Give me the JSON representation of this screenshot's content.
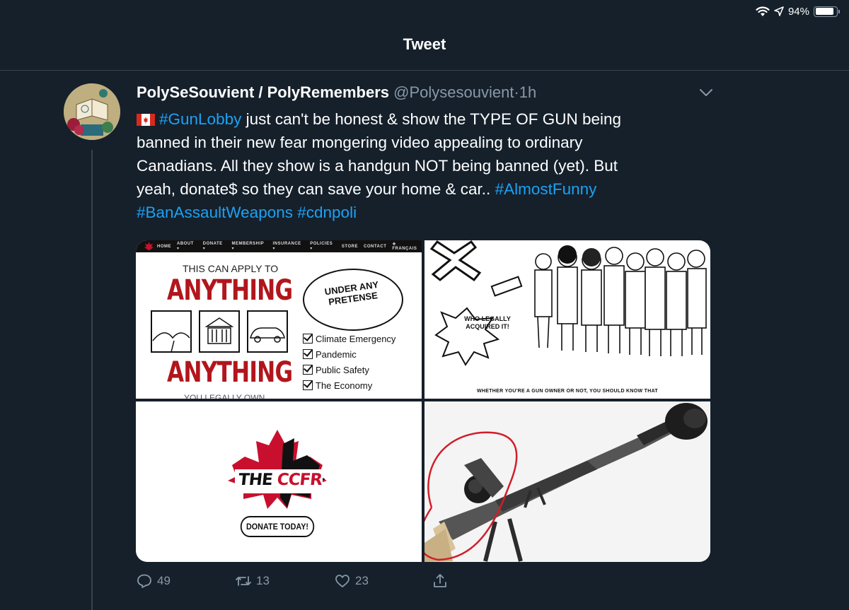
{
  "status_bar": {
    "battery": "94%",
    "battery_level": 0.94,
    "icons": [
      "wifi-icon",
      "location-icon",
      "battery-icon"
    ]
  },
  "header": {
    "title": "Tweet"
  },
  "tweet": {
    "author_name": "PolySeSouvient / PolyRemembers",
    "handle": "@Polysesouvient",
    "separator": "·",
    "time": "1h",
    "lines": [
      [
        {
          "t": "flag",
          "v": "canada-flag-icon"
        },
        {
          "t": "link",
          "v": "#GunLobby"
        },
        {
          "t": "text",
          "v": " just can't be honest & show the TYPE OF GUN being"
        }
      ],
      [
        {
          "t": "text",
          "v": "banned in their new fear mongering video appealing to ordinary"
        }
      ],
      [
        {
          "t": "text",
          "v": "Canadians. All they show is a handgun NOT being banned (yet). But"
        }
      ],
      [
        {
          "t": "text",
          "v": "yeah, donate$ so they can save your home & car.. "
        },
        {
          "t": "link",
          "v": "#AlmostFunny"
        }
      ],
      [
        {
          "t": "link",
          "v": "#BanAssaultWeapons"
        },
        {
          "t": "text",
          "v": " "
        },
        {
          "t": "link",
          "v": "#cdnpoli"
        }
      ]
    ],
    "media": {
      "image1": {
        "nav_items": [
          "HOME",
          "ABOUT ▾",
          "DONATE ▾",
          "MEMBERSHIP ▾",
          "INSURANCE ▾",
          "POLICIES ▾",
          "STORE",
          "CONTACT",
          "✚ FRANÇAIS"
        ],
        "top_text": "THIS CAN APPLY TO",
        "headline": "ANYTHING",
        "headline2": "ANYTHING",
        "bubble_text": "UNDER ANY PRETENSE",
        "checklist": [
          "Climate Emergency",
          "Pandemic",
          "Public Safety",
          "The Economy"
        ],
        "cut_text": "YOU LEGALLY OWN"
      },
      "image2": {
        "bubble_text": "WHO LEGALLY ACQUIRED IT!",
        "caption": "WHETHER YOU'RE A GUN OWNER OR NOT, YOU SHOULD KNOW THAT"
      },
      "image3": {
        "logo_the": "THE",
        "logo_ccfr": "CCFR",
        "button": "DONATE TODAY!"
      }
    },
    "actions": {
      "replies": "49",
      "retweets": "13",
      "likes": "23"
    }
  },
  "colors": {
    "background": "#15202b",
    "link": "#1da1f2",
    "muted": "#8899a6",
    "ccfr_red": "#c8102e"
  }
}
